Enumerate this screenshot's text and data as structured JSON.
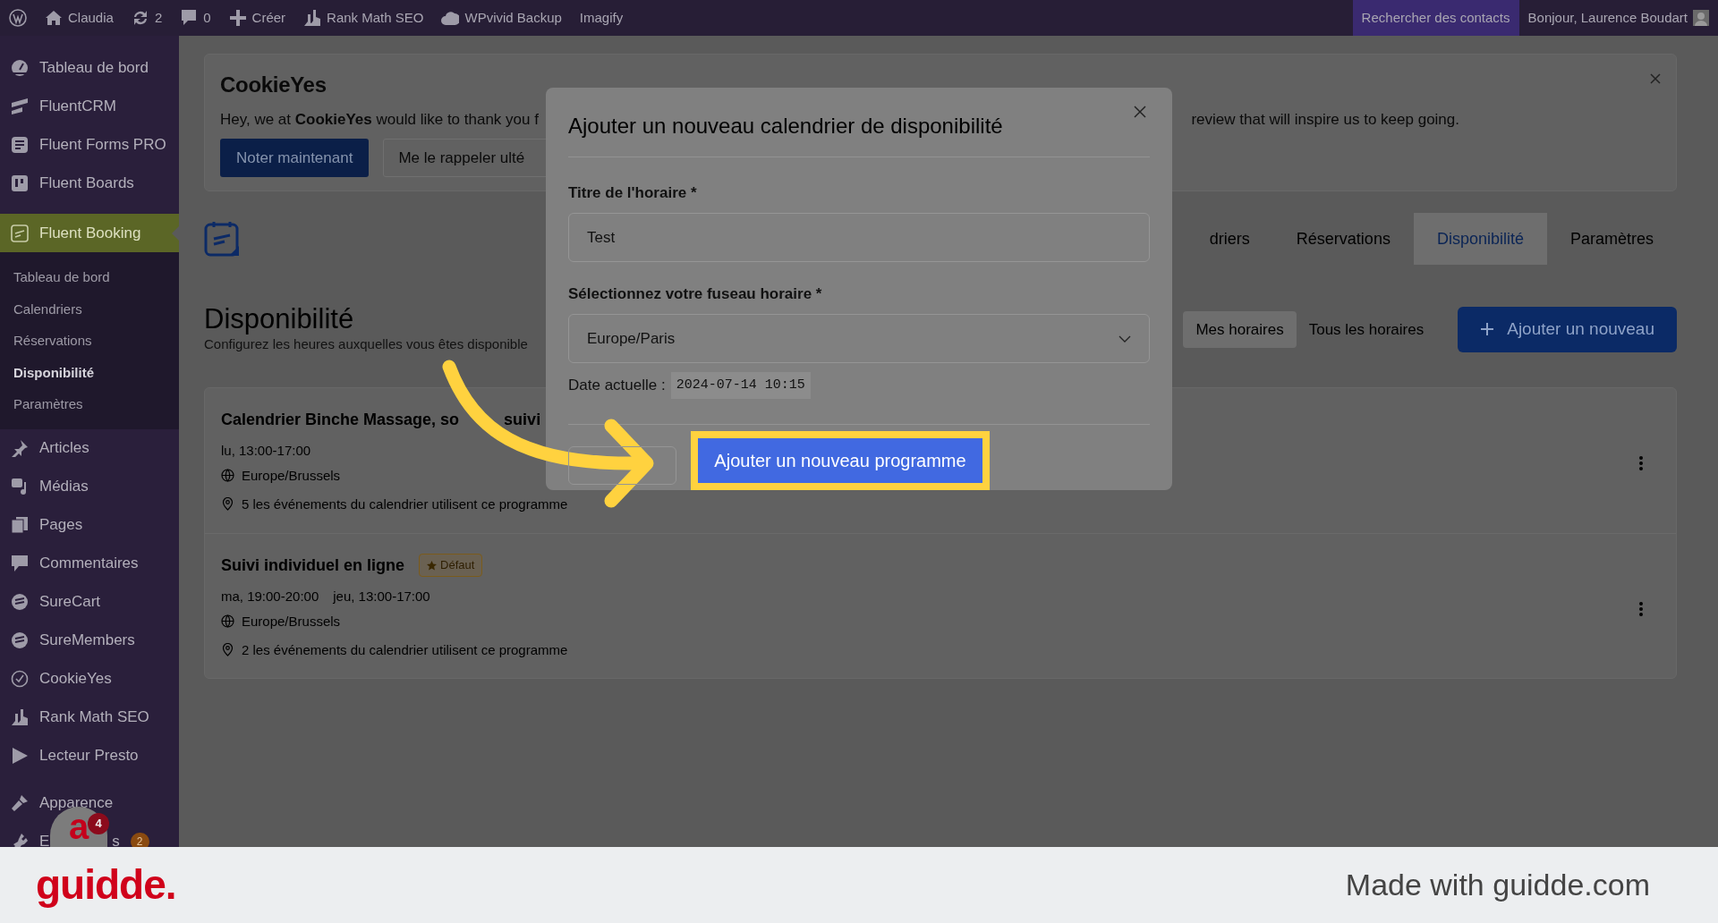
{
  "admin_bar": {
    "items": [
      {
        "label": "Claudia"
      },
      {
        "label": "2"
      },
      {
        "label": "0"
      },
      {
        "label": "Créer"
      },
      {
        "label": "Rank Math SEO"
      },
      {
        "label": "WPvivid Backup"
      },
      {
        "label": "Imagify"
      }
    ],
    "search_contacts": "Rechercher des contacts",
    "greeting": "Bonjour, Laurence Boudart"
  },
  "sidebar": {
    "items": [
      {
        "label": "Tableau de bord",
        "selected": false
      },
      {
        "label": "FluentCRM",
        "selected": false
      },
      {
        "label": "Fluent Forms PRO",
        "selected": false
      },
      {
        "label": "Fluent Boards",
        "selected": false
      },
      {
        "label": "Fluent Booking",
        "selected": true,
        "children": [
          {
            "label": "Tableau de bord",
            "selected": false
          },
          {
            "label": "Calendriers",
            "selected": false
          },
          {
            "label": "Réservations",
            "selected": false
          },
          {
            "label": "Disponibilité",
            "selected": true
          },
          {
            "label": "Paramètres",
            "selected": false
          }
        ]
      },
      {
        "label": "Articles",
        "selected": false
      },
      {
        "label": "Médias",
        "selected": false
      },
      {
        "label": "Pages",
        "selected": false
      },
      {
        "label": "Commentaires",
        "selected": false
      },
      {
        "label": "SureCart",
        "selected": false
      },
      {
        "label": "SureMembers",
        "selected": false
      },
      {
        "label": "CookieYes",
        "selected": false
      },
      {
        "label": "Rank Math SEO",
        "selected": false
      },
      {
        "label": "Lecteur Presto",
        "selected": false
      },
      {
        "label": "Apparence",
        "selected": false
      },
      {
        "label": "E",
        "label_tail": "s",
        "selected": false,
        "badge": "2"
      }
    ]
  },
  "floating_widget": {
    "logo": "a",
    "badge": "4"
  },
  "notice": {
    "logo": "CookieYes",
    "text": "Hey, we at **CookieYes** would like to thank you f",
    "text_right": "review that will inspire us to keep going.",
    "buttons": [
      {
        "label": "Noter maintenant",
        "kind": "primary"
      },
      {
        "label": "Me le rappeler ulté",
        "kind": "outline"
      }
    ]
  },
  "app_header": {
    "tabs": [
      {
        "label": "driers",
        "selected": false
      },
      {
        "label": "Réservations",
        "selected": false
      },
      {
        "label": "Disponibilité",
        "selected": true
      },
      {
        "label": "Paramètres",
        "selected": false
      }
    ]
  },
  "page": {
    "title": "Disponibilité",
    "subtitle": "Configurez les heures auxquelles vous êtes disponible",
    "filters": [
      {
        "label": "Mes horaires",
        "selected": true
      },
      {
        "label": "Tous les horaires",
        "selected": false
      }
    ],
    "add_button": "Ajouter un nouveau"
  },
  "schedules": [
    {
      "title": "Calendrier Binche Massage, so",
      "title_tail": "suivi",
      "times": [
        "lu, 13:00-17:00"
      ],
      "timezone": "Europe/Brussels",
      "usage": "5 les événements du calendrier utilisent ce programme"
    },
    {
      "title": "Suivi individuel en ligne",
      "default_badge": "Défaut",
      "times": [
        "ma, 19:00-20:00",
        "jeu, 13:00-17:00"
      ],
      "timezone": "Europe/Brussels",
      "usage": "2 les événements du calendrier utilisent ce programme"
    }
  ],
  "modal": {
    "title": "Ajouter un nouveau calendrier de disponibilité",
    "title_label": "Titre de l'horaire *",
    "title_value": "Test",
    "timezone_label": "Sélectionnez votre fuseau horaire *",
    "timezone_value": "Europe/Paris",
    "date_label": "Date actuelle :",
    "date_value": "2024-07-14 10:15",
    "submit": "Ajouter un nouveau programme",
    "highlighted": true
  },
  "footer": {
    "logo": "guidde.",
    "text": "Made with guidde.com"
  }
}
